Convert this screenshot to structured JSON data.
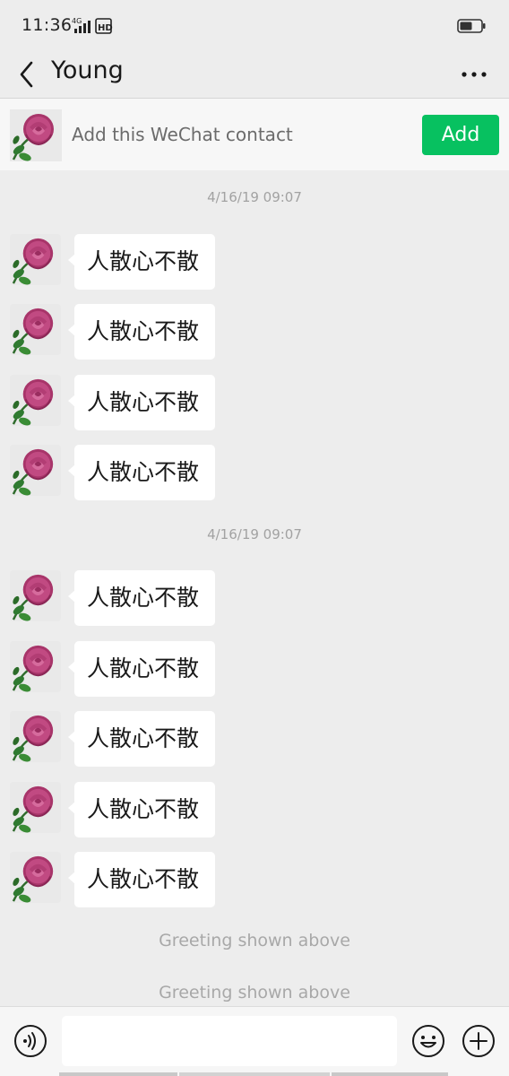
{
  "status_bar": {
    "time": "11:36",
    "network_icons": [
      "4g-signal-icon",
      "hd-icon"
    ],
    "battery_icon": "battery-icon"
  },
  "nav": {
    "back_icon": "chevron-left-icon",
    "title": "Young",
    "more_icon": "more-dots-icon"
  },
  "add_banner": {
    "text": "Add this WeChat contact",
    "button_label": "Add",
    "button_color": "#07c160"
  },
  "chat": {
    "groups": [
      {
        "timestamp": "4/16/19 09:07",
        "messages": [
          "人散心不散",
          "人散心不散",
          "人散心不散",
          "人散心不散"
        ]
      },
      {
        "timestamp": "4/16/19 09:07",
        "messages": [
          "人散心不散",
          "人散心不散",
          "人散心不散",
          "人散心不散",
          "人散心不散"
        ]
      }
    ],
    "system_notes": [
      "Greeting shown above",
      "Greeting shown above"
    ]
  },
  "input_bar": {
    "voice_icon": "voice-icon",
    "emoji_icon": "emoji-icon",
    "plus_icon": "plus-icon"
  },
  "colors": {
    "background": "#ededed",
    "bubble": "#ffffff",
    "accent": "#07c160"
  }
}
